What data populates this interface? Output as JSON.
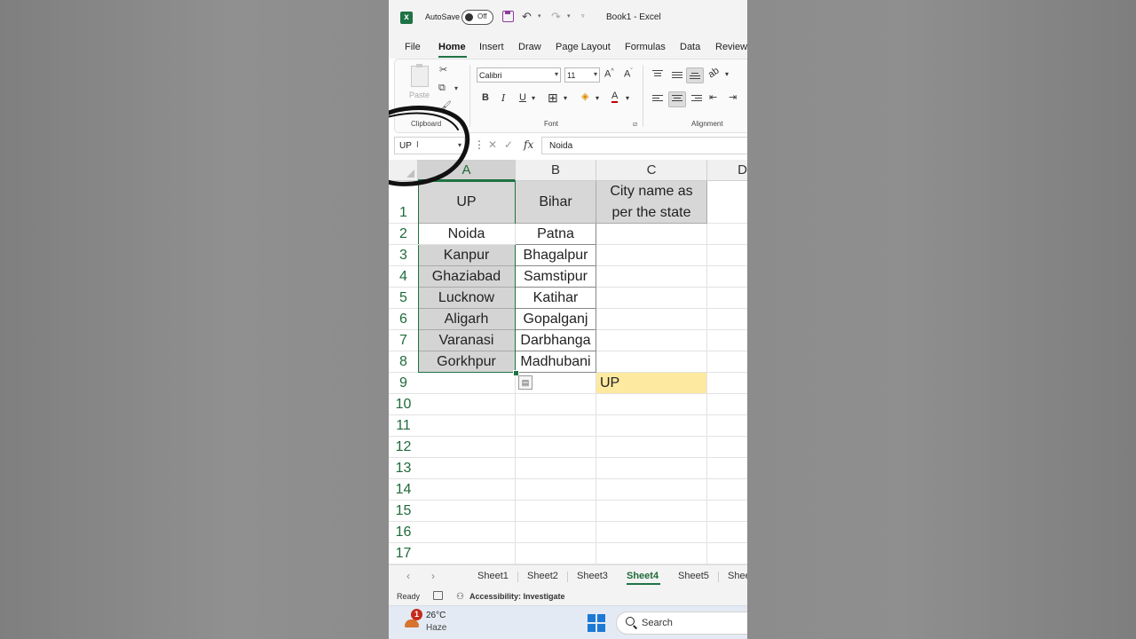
{
  "titlebar": {
    "autosave_label": "AutoSave",
    "autosave_state": "Off",
    "doc_title": "Book1  -  Excel"
  },
  "ribbon_tabs": [
    "File",
    "Home",
    "Insert",
    "Draw",
    "Page Layout",
    "Formulas",
    "Data",
    "Review"
  ],
  "ribbon": {
    "paste_label": "Paste",
    "clipboard_label": "Clipboard",
    "font_label": "Font",
    "alignment_label": "Alignment",
    "font_name": "Calibri",
    "font_size": "11",
    "bold": "B",
    "italic": "I",
    "underline": "U"
  },
  "formula_bar": {
    "name_box": "UP",
    "fx": "fx",
    "value": "Noida"
  },
  "columns": [
    "A",
    "B",
    "C",
    "D"
  ],
  "rows": [
    "1",
    "2",
    "3",
    "4",
    "5",
    "6",
    "7",
    "8",
    "9",
    "10",
    "11",
    "12",
    "13",
    "14",
    "15",
    "16",
    "17"
  ],
  "cells": {
    "A1": "UP",
    "B1": "Bihar",
    "C1_line1": "City name as",
    "C1_line2": "per the state",
    "A": [
      "Noida",
      "Kanpur",
      "Ghaziabad",
      "Lucknow",
      "Aligarh",
      "Varanasi",
      "Gorkhpur"
    ],
    "B": [
      "Patna",
      "Bhagalpur",
      "Samstipur",
      "Katihar",
      "Gopalganj",
      "Darbhanga",
      "Madhubani"
    ],
    "C9": "UP"
  },
  "sheet_tabs": [
    "Sheet1",
    "Sheet2",
    "Sheet3",
    "Sheet4",
    "Sheet5",
    "Shee"
  ],
  "active_sheet": "Sheet4",
  "status": {
    "ready": "Ready",
    "accessibility": "Accessibility: Investigate"
  },
  "taskbar": {
    "badge": "1",
    "temperature": "26°C",
    "weather": "Haze",
    "search": "Search"
  },
  "colors": {
    "excel_green": "#1f7244",
    "highlight_yellow": "#fde9a0",
    "selected_gray": "#d4d4d4"
  }
}
